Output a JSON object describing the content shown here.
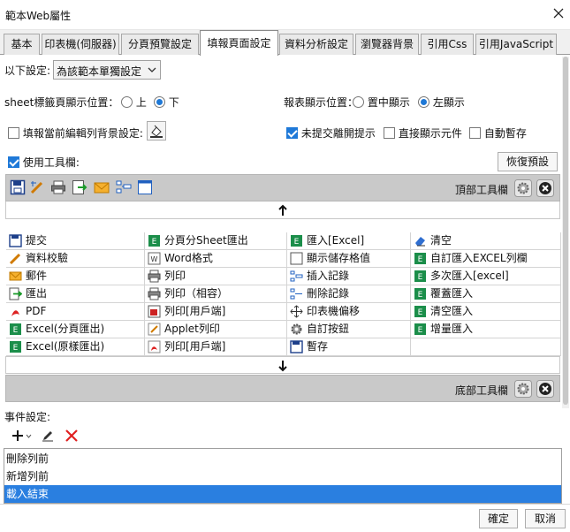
{
  "window": {
    "title": "範本Web屬性"
  },
  "tabs": [
    {
      "label": "基本"
    },
    {
      "label": "印表機(伺服器)"
    },
    {
      "label": "分頁預覽設定"
    },
    {
      "label": "填報頁面設定",
      "active": true
    },
    {
      "label": "資料分析設定"
    },
    {
      "label": "瀏覽器背景"
    },
    {
      "label": "引用Css"
    },
    {
      "label": "引用JavaScript"
    }
  ],
  "settings": {
    "scope_label": "以下設定:",
    "scope_value": "為該範本單獨設定",
    "sheet_tab_position_label": "sheet標籤頁顯示位置：",
    "sheet_tab_options": [
      "上",
      "下"
    ],
    "report_position_label": "報表顯示位置：",
    "report_position_options": [
      "置中顯示",
      "左顯示"
    ],
    "bg_label": "填報當前編輯列背景設定:",
    "unsubmitted_prompt": "未提交離開提示",
    "direct_show": "直接顯示元件",
    "auto_save": "自動暫存",
    "use_toolbar": "使用工具欄:",
    "restore_default": "恢復預設"
  },
  "toolbars": {
    "top_label": "頂部工具欄",
    "bottom_label": "底部工具欄"
  },
  "buttons_grid": [
    [
      "提交",
      "分頁分Sheet匯出",
      "匯入[Excel]",
      "清空"
    ],
    [
      "資料校驗",
      "Word格式",
      "顯示儲存格值",
      "自訂匯入EXCEL列欄"
    ],
    [
      "郵件",
      "列印",
      "插入記錄",
      "多次匯入[excel]"
    ],
    [
      "匯出",
      "列印（相容）",
      "刪除記錄",
      "覆蓋匯入"
    ],
    [
      "PDF",
      "列印[用戶端]",
      "印表機偏移",
      "清空匯入"
    ],
    [
      "Excel(分頁匯出)",
      "Applet列印",
      "自訂按鈕",
      "增量匯入"
    ],
    [
      "Excel(原樣匯出)",
      "列印[用戶端]",
      "暫存",
      ""
    ]
  ],
  "events": {
    "label": "事件設定:",
    "items": [
      "刪除列前",
      "新增列前",
      "載入結束"
    ],
    "selected_index": 2
  },
  "footer": {
    "ok": "確定",
    "cancel": "取消"
  },
  "colors": {
    "accent": "#2a7fe0",
    "strip": "#c9c9c9"
  }
}
